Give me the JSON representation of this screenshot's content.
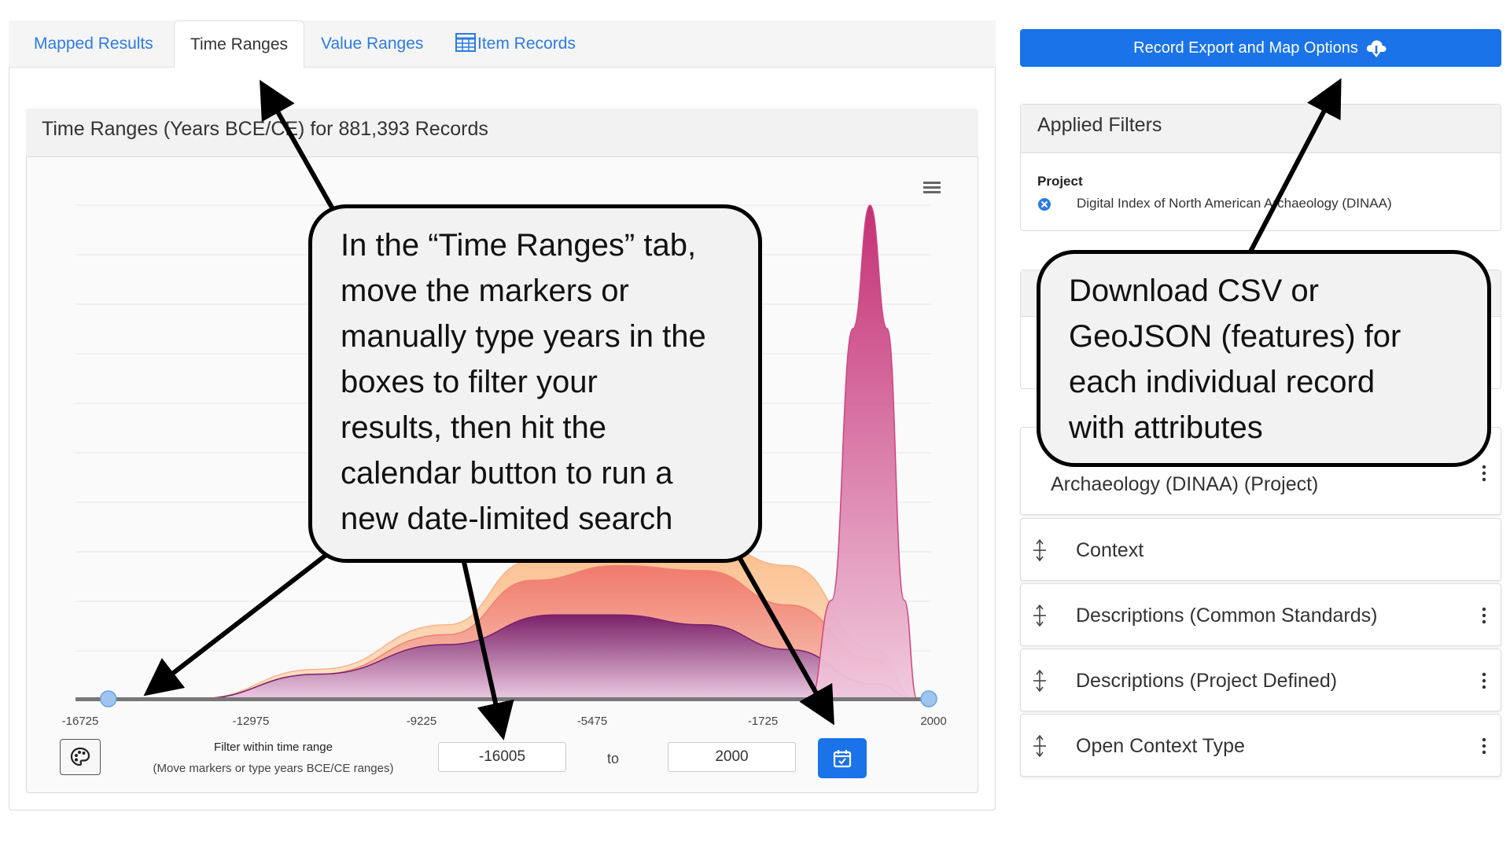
{
  "tabs": [
    {
      "label": "Mapped Results"
    },
    {
      "label": "Time Ranges"
    },
    {
      "label": "Value Ranges"
    },
    {
      "label": "Item Records",
      "icon": "table-icon"
    }
  ],
  "chart_card": {
    "title": "Time Ranges (Years BCE/CE) for 881,393 Records",
    "menu_icon": "hamburger-icon"
  },
  "chart_data": {
    "type": "area",
    "title": "Time Ranges (Years BCE/CE) for 881,393 Records",
    "x_ticks": [
      "-16725",
      "-12975",
      "-9225",
      "-5475",
      "-1725",
      "2000"
    ],
    "xlim": [
      -16725,
      2000
    ],
    "grid": true,
    "series": [
      {
        "color": "#7a1f6e",
        "points": [
          [
            -14900,
            0
          ],
          [
            -12000,
            0.05
          ],
          [
            -9000,
            0.11
          ],
          [
            -6500,
            0.17
          ],
          [
            -5000,
            0.17
          ],
          [
            -3000,
            0.15
          ],
          [
            -1000,
            0.1
          ],
          [
            1000,
            0.03
          ],
          [
            2000,
            0
          ]
        ]
      },
      {
        "color": "#f08070",
        "points": [
          [
            -14900,
            0
          ],
          [
            -12000,
            0.05
          ],
          [
            -9000,
            0.13
          ],
          [
            -7000,
            0.24
          ],
          [
            -5000,
            0.27
          ],
          [
            -3000,
            0.26
          ],
          [
            -1000,
            0.19
          ],
          [
            1000,
            0.08
          ],
          [
            2000,
            0
          ]
        ]
      },
      {
        "color": "#f9b48a",
        "points": [
          [
            -14900,
            0
          ],
          [
            -12000,
            0.06
          ],
          [
            -9000,
            0.15
          ],
          [
            -7000,
            0.28
          ],
          [
            -5000,
            0.32
          ],
          [
            -3000,
            0.32
          ],
          [
            -1000,
            0.27
          ],
          [
            1000,
            0.1
          ],
          [
            2000,
            0
          ]
        ]
      },
      {
        "color": "#d0457e",
        "points": [
          [
            -500,
            0
          ],
          [
            0,
            0.2
          ],
          [
            500,
            0.75
          ],
          [
            900,
            1.0
          ],
          [
            1300,
            0.75
          ],
          [
            1700,
            0.2
          ],
          [
            2000,
            0
          ]
        ]
      }
    ],
    "slider_range": [
      -16005,
      2000
    ]
  },
  "filter": {
    "label": "Filter within time range",
    "sublabel": "(Move markers or type years BCE/CE ranges)",
    "from_value": "-16005",
    "to_label": "to",
    "to_value": "2000",
    "palette_icon": "palette-icon",
    "submit_icon": "calendar-check-icon"
  },
  "export_button": {
    "label": "Record Export and Map Options",
    "icon": "cloud-download-icon"
  },
  "applied_filters": {
    "title": "Applied Filters",
    "group_label": "Project",
    "value": "Digital Index of North American Archaeology (DINAA)",
    "remove_icon": "close-circle-icon"
  },
  "facets": [
    {
      "label": "Archaeology (DINAA) (Project)"
    },
    {
      "label": "Context"
    },
    {
      "label": "Descriptions (Common Standards)"
    },
    {
      "label": "Descriptions (Project Defined)"
    },
    {
      "label": "Open Context Type"
    }
  ],
  "callouts": {
    "left": [
      "In the “Time Ranges” tab,",
      "move the markers or",
      "manually type years in the",
      "boxes to filter your",
      "results, then hit the",
      "calendar button to run a",
      "new date-limited search"
    ],
    "right": [
      "Download CSV or",
      "GeoJSON (features) for",
      "each individual record",
      "with attributes"
    ]
  },
  "colors": {
    "accent": "#1a73e8",
    "tab_link": "#2c7be5",
    "slider_handle": "#9ec5f0"
  }
}
